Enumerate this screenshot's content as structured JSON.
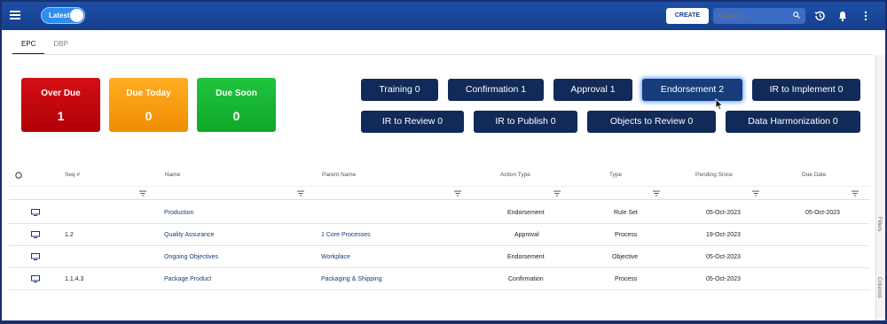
{
  "topbar": {
    "toggle_label": "Latest",
    "create_label": "CREATE",
    "search_placeholder": "Search..."
  },
  "tabs": [
    {
      "label": "EPC",
      "active": true
    },
    {
      "label": "DBP",
      "active": false
    }
  ],
  "cards": [
    {
      "title": "Over Due",
      "value": "1",
      "color": "#c8090e"
    },
    {
      "title": "Due Today",
      "value": "0",
      "color": "#f7a010"
    },
    {
      "title": "Due Soon",
      "value": "0",
      "color": "#18b633"
    }
  ],
  "status_buttons": {
    "training": "Training 0",
    "confirmation": "Confirmation 1",
    "approval": "Approval 1",
    "endorsement": "Endorsement 2",
    "ir_to_implement": "IR to Implement 0",
    "ir_to_review": "IR to Review 0",
    "ir_to_publish": "IR to Publish 0",
    "objects_to_review": "Objects to Review 0",
    "data_harmonization": "Data Harmonization 0"
  },
  "table": {
    "headers": {
      "seq": "Seq #",
      "name": "Name",
      "parent": "Parent Name",
      "action": "Action Type",
      "type": "Type",
      "pending": "Pending Since",
      "due": "Due Date"
    },
    "rows": [
      {
        "seq": "",
        "name": "Production",
        "parent": "",
        "action": "Endorsement",
        "type": "Rule Set",
        "pending": "05-Oct-2023",
        "due": "05-Oct-2023"
      },
      {
        "seq": "1.2",
        "name": "Quality Assurance",
        "parent": "1 Core Processes",
        "action": "Approval",
        "type": "Process",
        "pending": "19-Oct-2023",
        "due": ""
      },
      {
        "seq": "",
        "name": "Ongoing Objectives",
        "parent": "Workplace",
        "action": "Endorsement",
        "type": "Objective",
        "pending": "05-Oct-2023",
        "due": ""
      },
      {
        "seq": "1.1.4.3",
        "name": "Package Product",
        "parent": "Packaging & Shipping",
        "action": "Confirmation",
        "type": "Process",
        "pending": "05-Oct-2023",
        "due": ""
      }
    ]
  },
  "side_panel": {
    "filters_label": "Filters",
    "columns_label": "Columns"
  }
}
